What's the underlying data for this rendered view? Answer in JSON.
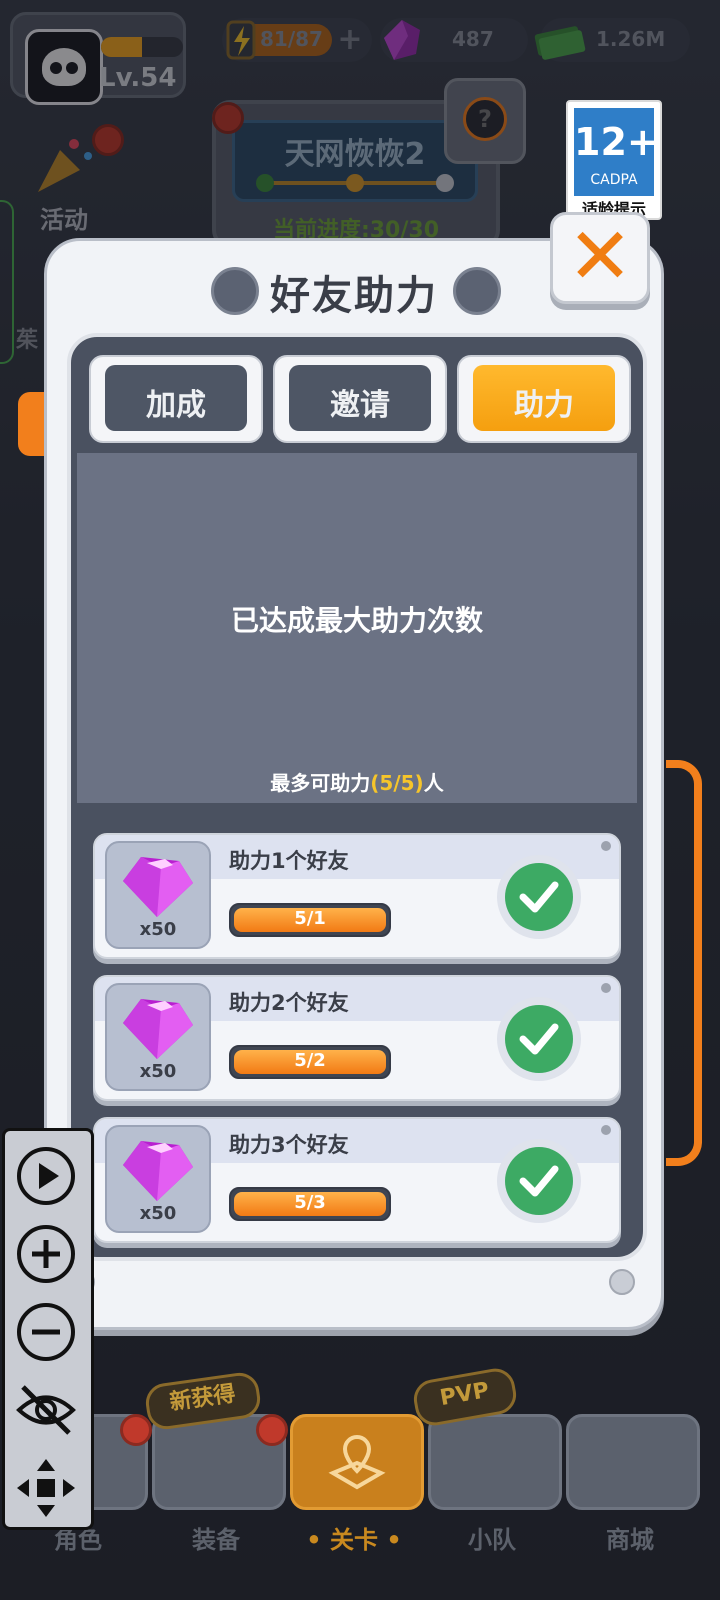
{
  "topbar": {
    "level": "Lv.54",
    "level_progress": 0.5,
    "energy": "81/87",
    "gems": "487",
    "cash": "1.26M"
  },
  "background": {
    "level_title": "天网恢恢2",
    "progress": "当前进度:30/30",
    "event_label": "活动",
    "side_label": "茱"
  },
  "age_rating": {
    "number": "12+",
    "org": "CADPA",
    "tip": "适龄提示"
  },
  "dialog": {
    "title": "好友助力",
    "tabs": [
      {
        "label": "加成",
        "active": false
      },
      {
        "label": "邀请",
        "active": false
      },
      {
        "label": "助力",
        "active": true
      }
    ],
    "status_main": "已达成最大助力次数",
    "status_sub_prefix": "最多可助力",
    "status_sub_value": "(5/5)",
    "status_sub_suffix": "人",
    "rewards": [
      {
        "title": "助力1个好友",
        "qty": "x50",
        "progress": "5/1",
        "fill": 1.0,
        "done": true
      },
      {
        "title": "助力2个好友",
        "qty": "x50",
        "progress": "5/2",
        "fill": 1.0,
        "done": true
      },
      {
        "title": "助力3个好友",
        "qty": "x50",
        "progress": "5/3",
        "fill": 1.0,
        "done": true
      }
    ]
  },
  "bottom_nav": {
    "items": [
      {
        "label": "角色",
        "active": false
      },
      {
        "label": "装备",
        "active": false
      },
      {
        "label": "• 关卡 •",
        "active": true
      },
      {
        "label": "小队",
        "active": false
      },
      {
        "label": "商城",
        "active": false
      }
    ],
    "badge_new": "新获得",
    "badge_pvp": "PVP"
  },
  "colors": {
    "accent_orange": "#f59f0f",
    "gem_purple": "#c02ad8",
    "check_green": "#3daa64",
    "highlight_yellow": "#f6c52a"
  }
}
